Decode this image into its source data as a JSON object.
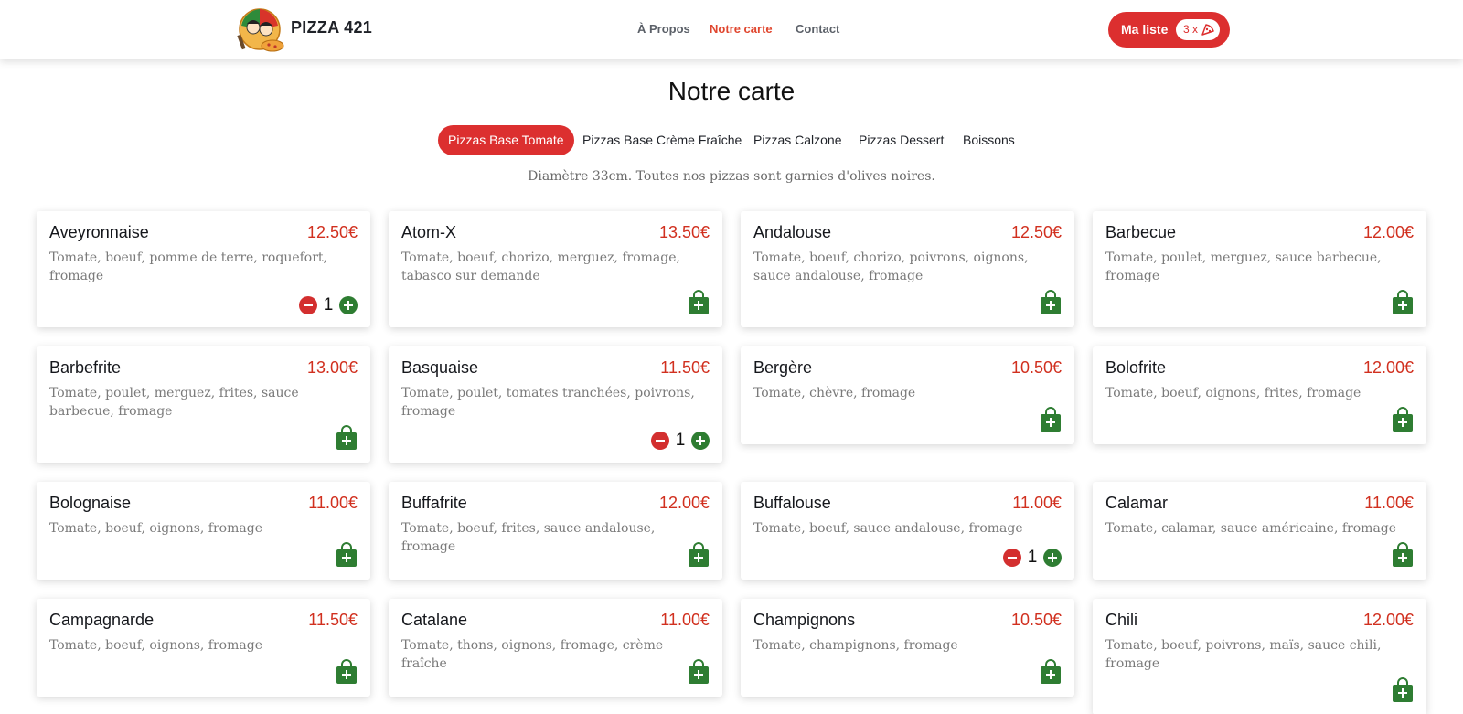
{
  "header": {
    "brand": "PIZZA 421",
    "nav": [
      {
        "label": "À Propos",
        "active": false
      },
      {
        "label": "Notre carte",
        "active": true
      },
      {
        "label": "Contact",
        "active": false
      }
    ],
    "cart": {
      "label": "Ma liste",
      "count": "3 x"
    }
  },
  "page": {
    "title": "Notre carte",
    "subtitle": "Diamètre 33cm. Toutes nos pizzas sont garnies d'olives noires."
  },
  "tabs": [
    {
      "label": "Pizzas Base Tomate",
      "active": true
    },
    {
      "label": "Pizzas Base Crème Fraîche",
      "active": false
    },
    {
      "label": "Pizzas Calzone",
      "active": false
    },
    {
      "label": "Pizzas Dessert",
      "active": false
    },
    {
      "label": "Boissons",
      "active": false
    }
  ],
  "colors": {
    "accent": "#dc2f2f",
    "price": "#d1301f",
    "add": "#2e7d32"
  },
  "pizzas": [
    {
      "name": "Aveyronnaise",
      "price": "12.50€",
      "desc": "Tomate, boeuf, pomme de terre, roquefort, fromage",
      "qty": "1"
    },
    {
      "name": "Atom-X",
      "price": "13.50€",
      "desc": "Tomate, boeuf, chorizo, merguez, fromage, tabasco sur demande",
      "qty": null
    },
    {
      "name": "Andalouse",
      "price": "12.50€",
      "desc": "Tomate, boeuf, chorizo, poivrons, oignons, sauce andalouse, fromage",
      "qty": null
    },
    {
      "name": "Barbecue",
      "price": "12.00€",
      "desc": "Tomate, poulet, merguez, sauce barbecue, fromage",
      "qty": null
    },
    {
      "name": "Barbefrite",
      "price": "13.00€",
      "desc": "Tomate, poulet, merguez, frites, sauce barbecue, fromage",
      "qty": null
    },
    {
      "name": "Basquaise",
      "price": "11.50€",
      "desc": "Tomate, poulet, tomates tranchées, poivrons, fromage",
      "qty": "1"
    },
    {
      "name": "Bergère",
      "price": "10.50€",
      "desc": "Tomate, chèvre, fromage",
      "qty": null
    },
    {
      "name": "Bolofrite",
      "price": "12.00€",
      "desc": "Tomate, boeuf, oignons, frites, fromage",
      "qty": null
    },
    {
      "name": "Bolognaise",
      "price": "11.00€",
      "desc": "Tomate, boeuf, oignons, fromage",
      "qty": null
    },
    {
      "name": "Buffafrite",
      "price": "12.00€",
      "desc": "Tomate, boeuf, frites, sauce andalouse, fromage",
      "qty": null
    },
    {
      "name": "Buffalouse",
      "price": "11.00€",
      "desc": "Tomate, boeuf, sauce andalouse, fromage",
      "qty": "1"
    },
    {
      "name": "Calamar",
      "price": "11.00€",
      "desc": "Tomate, calamar, sauce américaine, fromage",
      "qty": null
    },
    {
      "name": "Campagnarde",
      "price": "11.50€",
      "desc": "Tomate, boeuf, oignons, fromage",
      "qty": null
    },
    {
      "name": "Catalane",
      "price": "11.00€",
      "desc": "Tomate, thons, oignons, fromage, crème fraîche",
      "qty": null
    },
    {
      "name": "Champignons",
      "price": "10.50€",
      "desc": "Tomate, champignons, fromage",
      "qty": null
    },
    {
      "name": "Chili",
      "price": "12.00€",
      "desc": "Tomate, boeuf, poivrons, maïs, sauce chili, fromage",
      "qty": null
    }
  ]
}
